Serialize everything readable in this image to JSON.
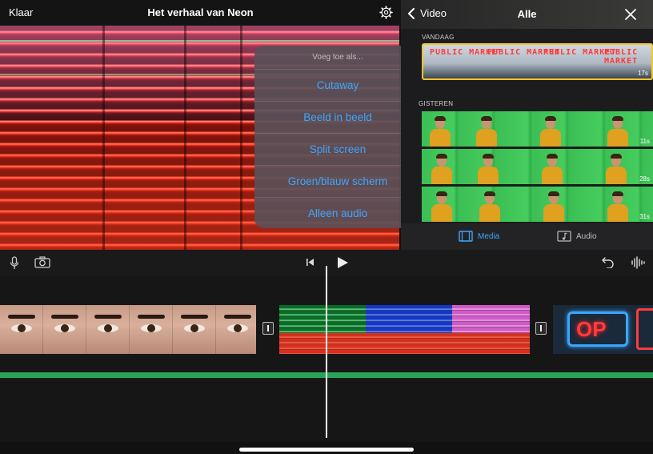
{
  "top_bar": {
    "done_label": "Klaar",
    "project_title": "Het verhaal van Neon",
    "settings_icon": "gear-icon"
  },
  "popover": {
    "title": "Voeg toe als...",
    "items": [
      {
        "label": "Cutaway"
      },
      {
        "label": "Beeld in beeld"
      },
      {
        "label": "Split screen"
      },
      {
        "label": "Groen/blauw scherm"
      },
      {
        "label": "Alleen audio"
      }
    ]
  },
  "browser": {
    "back_label": "Video",
    "title": "Alle",
    "close_icon": "close-icon",
    "sections": {
      "today": {
        "label": "VANDAAG",
        "clip_text": "PUBLIC MARKET",
        "clip_duration": "17s"
      },
      "yesterday": {
        "label": "GISTEREN",
        "clips": [
          {
            "duration": "11s"
          },
          {
            "duration": "28s"
          },
          {
            "duration": "31s"
          }
        ]
      }
    },
    "tabs": {
      "media_label": "Media",
      "audio_label": "Audio"
    }
  },
  "timeline_toolbar": {
    "icons": [
      "microphone-icon",
      "camera-icon",
      "skip-to-start-icon",
      "play-icon",
      "undo-icon",
      "waveform-icon"
    ]
  },
  "timeline": {
    "clips": [
      "eyes-clip",
      "neon-clip",
      "op-sign-clip"
    ],
    "neon_sign_text": "OP",
    "accent_colors": {
      "active_blue": "#3ea6ff",
      "selection_yellow": "#f7c52c",
      "audio_green": "#26a55a"
    }
  }
}
